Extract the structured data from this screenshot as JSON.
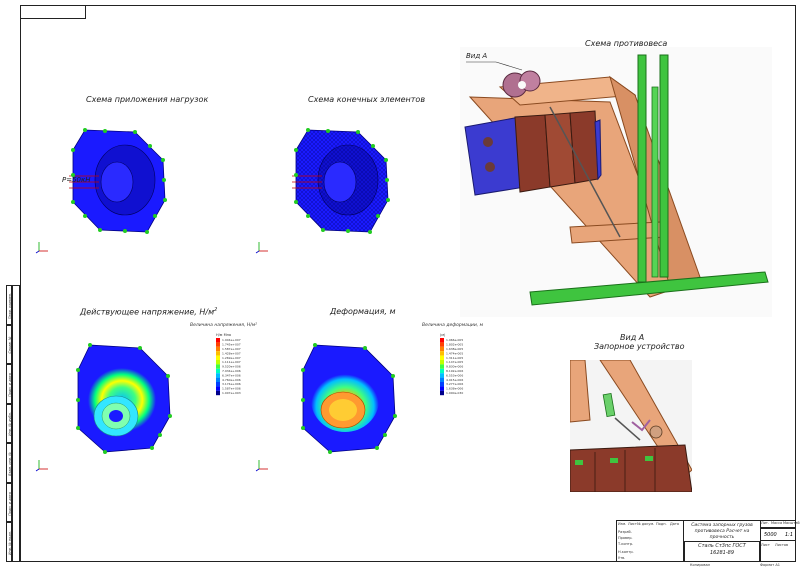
{
  "titles": {
    "load_scheme": "Схема приложения нагрузок",
    "fe_scheme": "Схема конечных элементов",
    "stress": "Действующее напряжение, Н/м",
    "stress_sup": "2",
    "deformation": "Деформация, м",
    "counterweight_scheme": "Схема противовеса",
    "view_a_callout": "Вид А",
    "view_a": "Вид А",
    "locking_device": "Запорное устройство"
  },
  "load_label": "Р=50кН",
  "legends": {
    "stress": {
      "title": "Величина напряжения, Н/м²",
      "unit": "Н/м  Мпа",
      "values": [
        "1.904e+007",
        "1.745e+007",
        "1.587e+007",
        "1.428e+007",
        "1.269e+007",
        "1.111e+007",
        "9.520e+006",
        "7.934e+006",
        "6.347e+006",
        "4.760e+006",
        "3.174e+006",
        "1.587e+006",
        "1.007e+003"
      ]
    },
    "deformation": {
      "title": "Величина деформации, м",
      "unit": "(м)",
      "values": [
        "1.966e-005",
        "1.802e-005",
        "1.638e-005",
        "1.474e-005",
        "1.311e-005",
        "1.147e-005",
        "9.830e-006",
        "8.192e-006",
        "6.553e-006",
        "4.915e-006",
        "3.277e-006",
        "1.638e-006",
        "1.000e-030"
      ]
    },
    "colors": [
      "#ff0000",
      "#ff4000",
      "#ff8000",
      "#ffbf00",
      "#ffff00",
      "#bfff00",
      "#40ff40",
      "#00ffbf",
      "#00bfff",
      "#0080ff",
      "#0040ff",
      "#0000ff",
      "#00008b"
    ]
  },
  "title_block": {
    "doc_title": "Система запорных грузов противовеса Расчет на прочность",
    "material": "Сталь Ст3пс ГОСТ 16281-89",
    "labels": [
      "Лит.",
      "Масса",
      "Масштаб"
    ],
    "scale": "1:1",
    "mass": "5000",
    "sheet": "Лист",
    "sheets": "Листов",
    "rows": [
      "Изм.",
      "Лист",
      "№ докум.",
      "Подп.",
      "Дата"
    ],
    "roles": [
      "Разраб.",
      "Провер.",
      "Т.контр.",
      "Н.контр.",
      "Утв."
    ],
    "copied": "Копировал",
    "format": "Формат А1"
  },
  "side_stamp": [
    "Перв. примен.",
    "Справ. №",
    "Подп. и дата",
    "Инв. № дубл.",
    "Взам. инв. №",
    "Подп. и дата",
    "Инв. № подл."
  ],
  "axis_labels": [
    "X",
    "Y",
    "Z"
  ]
}
